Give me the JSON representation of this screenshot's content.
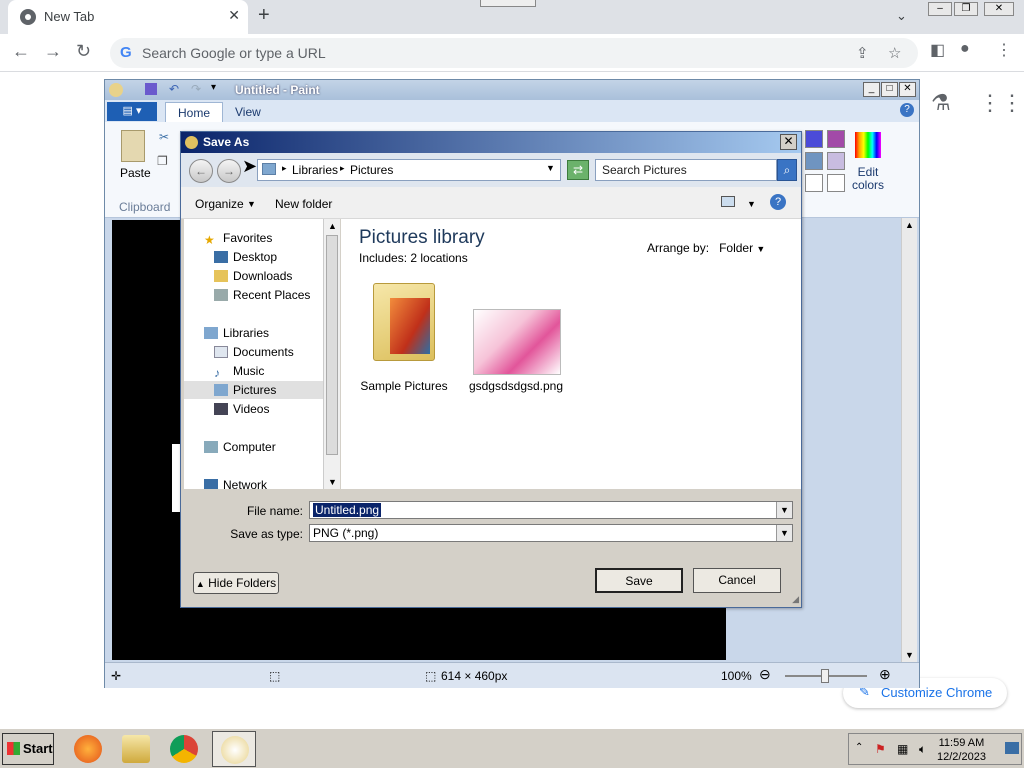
{
  "chrome": {
    "tab_title": "New Tab",
    "tab_close": "✕",
    "new_tab": "+",
    "omnibox_placeholder": "Search Google or type a URL",
    "customize_label": "Customize Chrome"
  },
  "paint": {
    "title": "Untitled - Paint",
    "tabs": [
      "Home",
      "View"
    ],
    "ribbon": {
      "paste_label": "Paste",
      "clipboard_label": "Clipboard",
      "edit_colors_label": "Edit colors"
    },
    "status": {
      "dimensions": "614 × 460px",
      "zoom": "100%"
    }
  },
  "dialog": {
    "title": "Save As",
    "breadcrumb": [
      "Libraries",
      "Pictures"
    ],
    "search_placeholder": "Search Pictures",
    "commands": {
      "organize": "Organize",
      "new_folder": "New folder"
    },
    "nav_pane": {
      "favorites_header": "Favorites",
      "favorites": [
        "Desktop",
        "Downloads",
        "Recent Places"
      ],
      "libraries_header": "Libraries",
      "libraries": [
        "Documents",
        "Music",
        "Pictures",
        "Videos"
      ],
      "computer": "Computer",
      "network": "Network",
      "selected": "Pictures"
    },
    "content": {
      "library_title": "Pictures library",
      "includes_text": "Includes:  2 locations",
      "arrange_by_label": "Arrange by:",
      "arrange_by_value": "Folder",
      "items": [
        {
          "name": "Sample Pictures",
          "type": "folder"
        },
        {
          "name": "gsdgsdsdgsd.png",
          "type": "image"
        }
      ]
    },
    "fields": {
      "file_name_label": "File name:",
      "file_name_value": "Untitled.png",
      "save_as_type_label": "Save as type:",
      "save_as_type_value": "PNG (*.png)"
    },
    "buttons": {
      "save": "Save",
      "cancel": "Cancel",
      "hide_folders": "Hide Folders"
    }
  },
  "taskbar": {
    "start_label": "Start",
    "time": "11:59 AM",
    "date": "12/2/2023"
  }
}
